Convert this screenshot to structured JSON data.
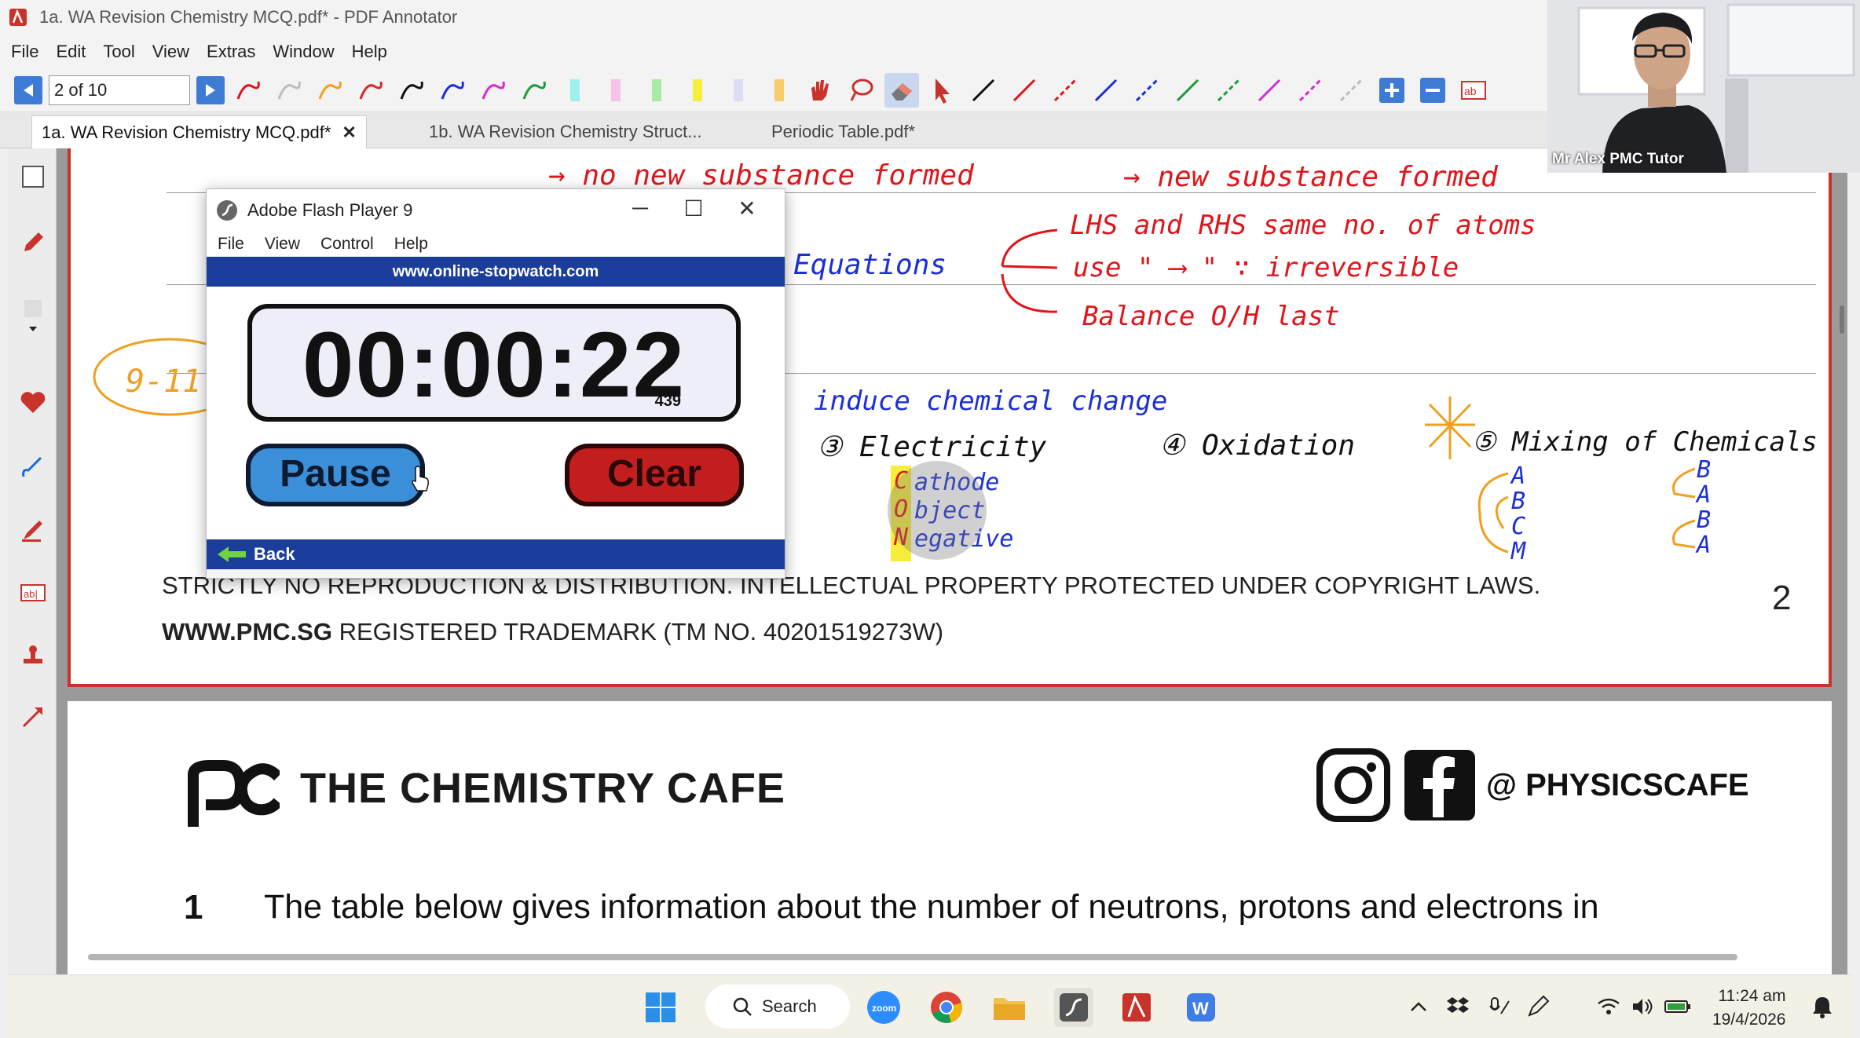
{
  "window": {
    "title": "1a. WA Revision Chemistry MCQ.pdf* - PDF Annotator"
  },
  "menu": [
    "File",
    "Edit",
    "Tool",
    "View",
    "Extras",
    "Window",
    "Help"
  ],
  "toolbar": {
    "page_indicator": "2 of 10"
  },
  "tabs": [
    {
      "label": "1a. WA Revision Chemistry MCQ.pdf*",
      "active": true
    },
    {
      "label": "1b. WA Revision Chemistry Struct...",
      "active": false
    },
    {
      "label": "Periodic Table.pdf*",
      "active": false
    }
  ],
  "page1": {
    "annotations": {
      "no_new": "→ no new substance formed",
      "new": "→ new substance formed",
      "equations": "Equations",
      "lhs": "LHS and RHS same no. of atoms",
      "use": "use \" ⟶ \" ∵ irreversible",
      "balance": "Balance O/H last",
      "range": "9-11",
      "induce": "induce chemical change",
      "item3": "③ Electricity",
      "item4": "④ Oxidation",
      "item5": "⑤ Mixing of Chemicals",
      "cathode": "athode",
      "object": "bject",
      "negative": "egative",
      "con": [
        "C",
        "O",
        "N"
      ],
      "abcm": [
        "A",
        "B",
        "C",
        "M"
      ],
      "babba": [
        "B",
        "A",
        "B",
        "A"
      ]
    },
    "copyright": "STRICTLY NO REPRODUCTION & DISTRIBUTION. INTELLECTUAL PROPERTY PROTECTED UNDER COPYRIGHT LAWS.",
    "trademark_bold": "WWW.PMC.SG",
    "trademark_rest": " REGISTERED TRADEMARK (TM NO. 40201519273W)",
    "page_number": "2"
  },
  "page2": {
    "brand": "THE CHEMISTRY CAFE",
    "social_handle": "@ PHYSICSCAFE",
    "question_number": "1",
    "question_text": "The table below gives information about the number of neutrons, protons and electrons in"
  },
  "flash": {
    "title": "Adobe Flash Player 9",
    "menu": [
      "File",
      "View",
      "Control",
      "Help"
    ],
    "banner": "www.online-stopwatch.com",
    "time": "00:00:22",
    "ms": "439",
    "pause": "Pause",
    "clear": "Clear",
    "back": "Back"
  },
  "webcam": {
    "label": "Mr Alex PMC Tutor"
  },
  "taskbar": {
    "search": "Search",
    "time": "11:24 am",
    "date": "19/4/2026"
  },
  "colors": {
    "annot_red": "#e0151b",
    "annot_blue": "#1c2fd6",
    "annot_orange": "#f0a020",
    "page_border": "#c8342c",
    "flash_blue": "#1b3e9c"
  }
}
